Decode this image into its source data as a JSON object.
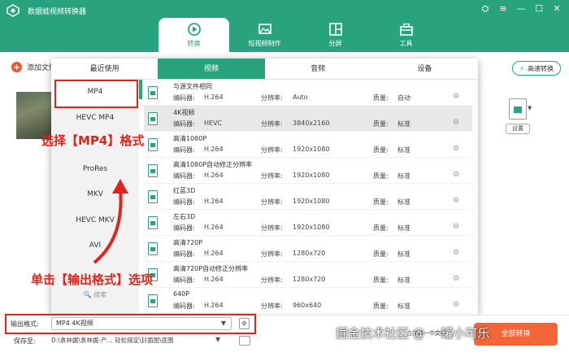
{
  "app": {
    "title": "数据蛙视频转换器"
  },
  "window_controls": [
    "⛭",
    "≡",
    "—",
    "☐",
    "✕"
  ],
  "nav": {
    "tabs": [
      {
        "label": "转换",
        "icon": "convert-icon",
        "active": true
      },
      {
        "label": "短视频制作",
        "icon": "image-icon",
        "active": false
      },
      {
        "label": "分屏",
        "icon": "split-screen-icon",
        "active": false
      },
      {
        "label": "工具",
        "icon": "toolbox-icon",
        "active": false
      }
    ]
  },
  "toolbar": {
    "add_file": "添加文件",
    "high_speed": "高速转换"
  },
  "side": {
    "settings_chip": "设置"
  },
  "popup": {
    "tabs": [
      {
        "label": "最近使用",
        "active": false
      },
      {
        "label": "视频",
        "active": true
      },
      {
        "label": "音频",
        "active": false
      },
      {
        "label": "设备",
        "active": false
      }
    ],
    "formats": [
      "MP4",
      "HEVC MP4",
      "",
      "ProRes",
      "MKV",
      "HEVC MKV",
      "AVI"
    ],
    "selected_format": "MP4",
    "search_label": "🔍 搜索",
    "field_labels": {
      "encoder": "编码器:",
      "resolution": "分辨率:",
      "quality": "质量:"
    },
    "presets": [
      {
        "name": "与源文件相同",
        "encoder": "H.264",
        "resolution": "Auto",
        "quality": "自动",
        "highlight": false
      },
      {
        "name": "4K视频",
        "encoder": "HEVC",
        "resolution": "3840x2160",
        "quality": "标准",
        "highlight": true
      },
      {
        "name": "高清1080P",
        "encoder": "H.264",
        "resolution": "1920x1080",
        "quality": "标准",
        "highlight": false
      },
      {
        "name": "高清1080P自动修正分辨率",
        "encoder": "H.264",
        "resolution": "1920x1080",
        "quality": "标准",
        "highlight": false
      },
      {
        "name": "红蓝3D",
        "encoder": "H.264",
        "resolution": "1920x1080",
        "quality": "标准",
        "highlight": false
      },
      {
        "name": "左右3D",
        "encoder": "H.264",
        "resolution": "1920x1080",
        "quality": "标准",
        "highlight": false
      },
      {
        "name": "高清720P",
        "encoder": "H.264",
        "resolution": "1280x720",
        "quality": "标准",
        "highlight": false
      },
      {
        "name": "高清720P自动修正分辨率",
        "encoder": "H.264",
        "resolution": "1280x720",
        "quality": "标准",
        "highlight": false
      },
      {
        "name": "640P",
        "encoder": "H.264",
        "resolution": "960x640",
        "quality": "标准",
        "highlight": false
      }
    ]
  },
  "output": {
    "label": "输出格式:",
    "value": "MP4 4K视频",
    "save_label": "保存至:",
    "save_path": "D:\\袁林娓\\袁林娓-产... 轻松搞定\\封面图\\底图",
    "merge_label": "合并成一个文件",
    "convert_label": "全部转换"
  },
  "annotations": {
    "select_mp4": "选择【MP4】格式",
    "click_output": "单击【输出格式】选项"
  },
  "watermark": "掘金技术社区 @ 一罐小可乐",
  "colors": {
    "brand": "#29a37f",
    "annotation": "#e0241a",
    "convert": "#f4663a"
  }
}
